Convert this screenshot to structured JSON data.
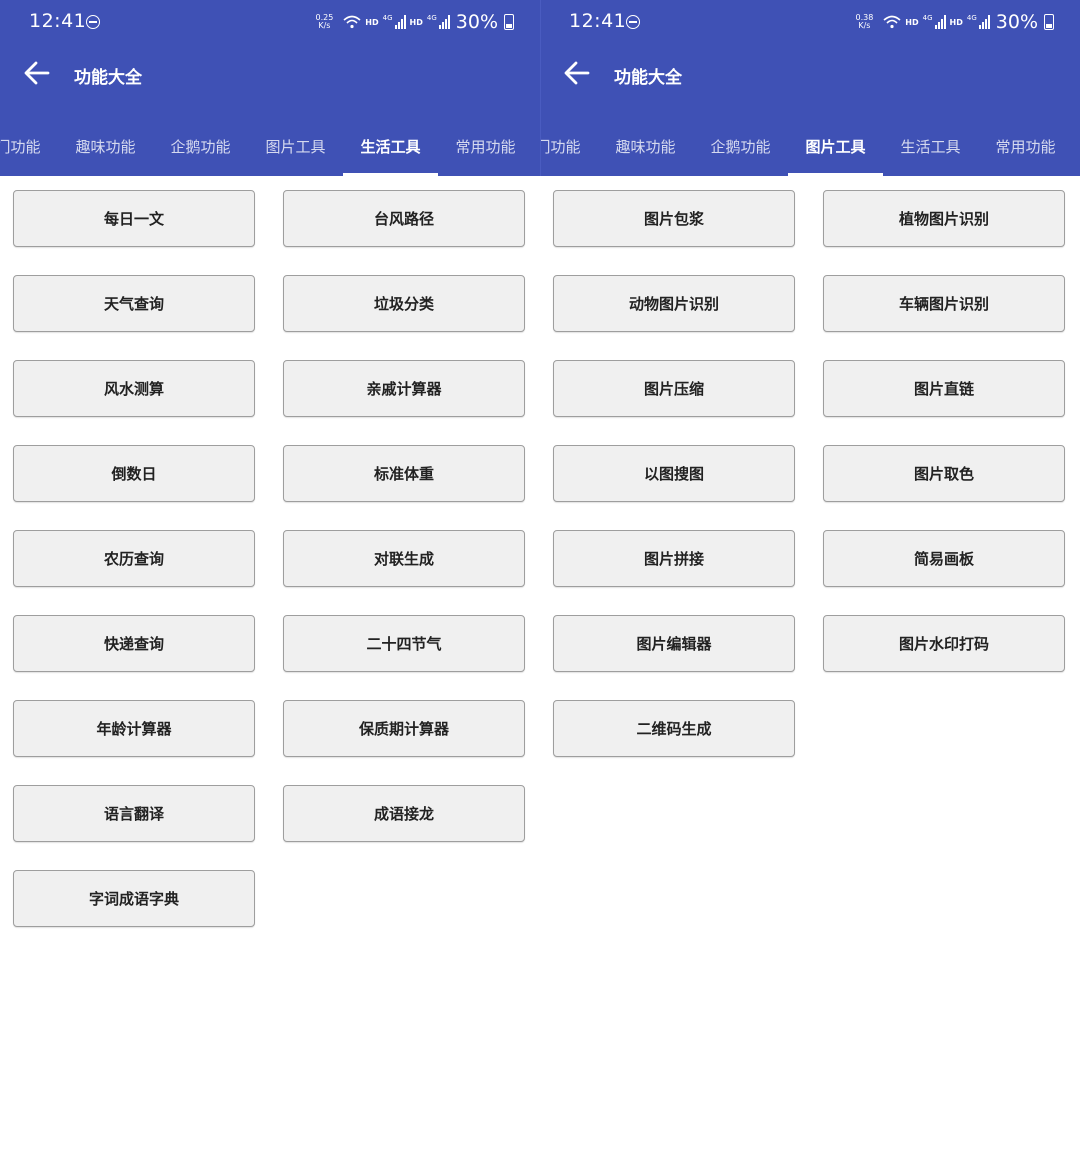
{
  "left": {
    "status": {
      "time": "12:41",
      "speed_value": "0.25",
      "speed_unit": "K/s",
      "hd1": "HD",
      "net1": "4G",
      "hd2": "HD",
      "net2": "4G",
      "battery": "30%"
    },
    "title": "功能大全",
    "tabs": [
      "热门功能",
      "趣味功能",
      "企鹅功能",
      "图片工具",
      "生活工具",
      "常用功能"
    ],
    "active_tab": "生活工具",
    "buttons": [
      "每日一文",
      "台风路径",
      "天气查询",
      "垃圾分类",
      "风水测算",
      "亲戚计算器",
      "倒数日",
      "标准体重",
      "农历查询",
      "对联生成",
      "快递查询",
      "二十四节气",
      "年龄计算器",
      "保质期计算器",
      "语言翻译",
      "成语接龙",
      "字词成语字典"
    ]
  },
  "right": {
    "status": {
      "time": "12:41",
      "speed_value": "0.38",
      "speed_unit": "K/s",
      "hd1": "HD",
      "net1": "4G",
      "hd2": "HD",
      "net2": "4G",
      "battery": "30%"
    },
    "title": "功能大全",
    "tabs": [
      "热门功能",
      "趣味功能",
      "企鹅功能",
      "图片工具",
      "生活工具",
      "常用功能"
    ],
    "active_tab": "图片工具",
    "buttons": [
      "图片包浆",
      "植物图片识别",
      "动物图片识别",
      "车辆图片识别",
      "图片压缩",
      "图片直链",
      "以图搜图",
      "图片取色",
      "图片拼接",
      "简易画板",
      "图片编辑器",
      "图片水印打码",
      "二维码生成"
    ]
  },
  "colors": {
    "appbar": "#3f51b5",
    "button_bg": "#f0f0f0",
    "button_border": "#9e9e9e"
  },
  "icons": {
    "back": "arrow-left-icon",
    "dnd": "do-not-disturb-icon",
    "wifi": "wifi-icon",
    "signal": "signal-icon",
    "battery": "battery-icon"
  }
}
